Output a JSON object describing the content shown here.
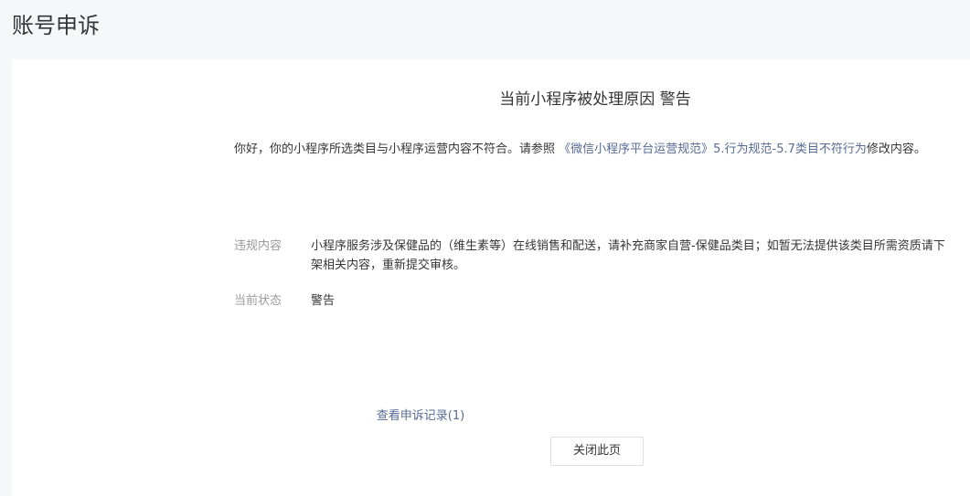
{
  "header": {
    "title": "账号申诉"
  },
  "main": {
    "reason_title_prefix": "当前小程序被处理原因",
    "reason_title_status": "警告",
    "intro": {
      "before_link": "你好，你的小程序所选类目与小程序运营内容不符合。请参照 ",
      "link_text": "《微信小程序平台运营规范》5.行为规范-5.7类目不符行为",
      "after_link": "修改内容。"
    },
    "violation": {
      "label": "违规内容",
      "value": "小程序服务涉及保健品的（维生素等）在线销售和配送，请补充商家自营-保健品类目；如暂无法提供该类目所需资质请下架相关内容，重新提交审核。"
    },
    "status": {
      "label": "当前状态",
      "value": "警告"
    },
    "records_link": "查看申诉记录(1)",
    "close_button": "关闭此页"
  },
  "colors": {
    "link": "#576b95",
    "label": "#9a9a9a",
    "text": "#353535",
    "background": "#f6f7f9"
  }
}
